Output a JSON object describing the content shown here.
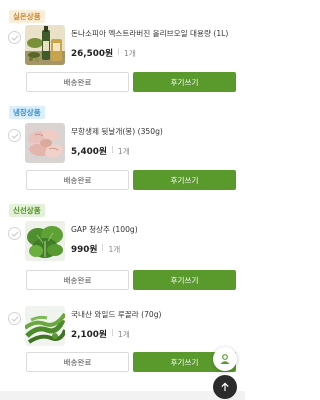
{
  "categories": [
    {
      "label": "실온상품",
      "badge_bg": "#fbeed9",
      "badge_color": "#c98a34",
      "item": {
        "name": "돈나소피아 엑스트라버진 올리브오일 대용량 (1L)",
        "price": "26,500원",
        "qty": "1개",
        "image_icon": "olive-oil-bottle"
      }
    },
    {
      "label": "냉장상품",
      "badge_bg": "#dbeefb",
      "badge_color": "#3c8fc8",
      "item": {
        "name": "무항생제 뒷날개(봉) (350g)",
        "price": "5,400원",
        "qty": "1개",
        "image_icon": "chicken-wings"
      }
    },
    {
      "label": "신선상품",
      "badge_bg": "#e2f1d7",
      "badge_color": "#4f8e26",
      "item": {
        "name": "GAP 청상추 (100g)",
        "price": "990원",
        "qty": "1개",
        "image_icon": "lettuce"
      }
    }
  ],
  "extra_item": {
    "name": "국내산 와일드 루꼴라 (70g)",
    "price": "2,100원",
    "qty": "1개",
    "image_icon": "arugula"
  },
  "buttons": {
    "shipping_done": "배송완료",
    "write_review": "후기쓰기"
  },
  "colors": {
    "accent_green": "#5a9a2c",
    "top_button": "#2b2b2b"
  }
}
